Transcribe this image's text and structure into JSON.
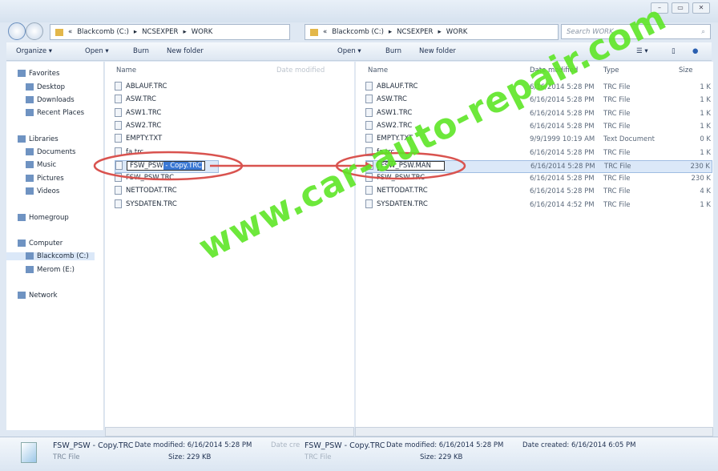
{
  "window": {
    "buttons": [
      "minimize",
      "maximize",
      "close"
    ]
  },
  "address": {
    "left": [
      "«",
      "Blackcomb (C:)",
      "▸",
      "NCSEXPER",
      "▸",
      "WORK"
    ],
    "right": [
      "«",
      "Blackcomb (C:)",
      "▸",
      "NCSEXPER",
      "▸",
      "WORK"
    ]
  },
  "search": {
    "placeholder": "Search WORK"
  },
  "toolbar": {
    "organize": "Organize ▾",
    "open": "Open ▾",
    "burn": "Burn",
    "new_folder": "New folder"
  },
  "nav": {
    "items": [
      {
        "label": "Favorites",
        "icon": "star-icon"
      },
      {
        "label": "Desktop",
        "icon": "desktop-icon"
      },
      {
        "label": "Downloads",
        "icon": "downloads-icon"
      },
      {
        "label": "Recent Places",
        "icon": "recent-icon"
      },
      {
        "label": "Libraries",
        "icon": "libraries-icon"
      },
      {
        "label": "Documents",
        "icon": "documents-icon"
      },
      {
        "label": "Music",
        "icon": "music-icon"
      },
      {
        "label": "Pictures",
        "icon": "pictures-icon"
      },
      {
        "label": "Videos",
        "icon": "videos-icon"
      },
      {
        "label": "Homegroup",
        "icon": "homegroup-icon"
      },
      {
        "label": "Computer",
        "icon": "computer-icon"
      },
      {
        "label": "Blackcomb (C:)",
        "icon": "drive-icon"
      },
      {
        "label": "Merom (E:)",
        "icon": "drive-icon"
      },
      {
        "label": "Network",
        "icon": "network-icon"
      }
    ]
  },
  "columns": {
    "name": "Name",
    "date": "Date modified",
    "type": "Type",
    "size": "Size"
  },
  "left_files": [
    "ABLAUF.TRC",
    "ASW.TRC",
    "ASW1.TRC",
    "ASW2.TRC",
    "EMPTY.TXT",
    "fa.trc",
    "FSW_PSW",
    "FSW_PSW.TRC",
    "NETTODAT.TRC",
    "SYSDATEN.TRC"
  ],
  "left_edit": {
    "base": "FSW_PSW",
    "selected": " - Copy.TRC"
  },
  "right_files": [
    {
      "name": "ABLAUF.TRC",
      "date": "6/16/2014 5:28 PM",
      "type": "TRC File",
      "size": "1 K"
    },
    {
      "name": "ASW.TRC",
      "date": "6/16/2014 5:28 PM",
      "type": "TRC File",
      "size": "1 K"
    },
    {
      "name": "ASW1.TRC",
      "date": "6/16/2014 5:28 PM",
      "type": "TRC File",
      "size": "1 K"
    },
    {
      "name": "ASW2.TRC",
      "date": "6/16/2014 5:28 PM",
      "type": "TRC File",
      "size": "1 K"
    },
    {
      "name": "EMPTY.TXT",
      "date": "9/9/1999 10:19 AM",
      "type": "Text Document",
      "size": "0 K"
    },
    {
      "name": "fa.trc",
      "date": "6/16/2014 5:28 PM",
      "type": "TRC File",
      "size": "1 K"
    },
    {
      "name": "FSW_PSW.MAN",
      "date": "6/16/2014 5:28 PM",
      "type": "TRC File",
      "size": "230 K"
    },
    {
      "name": "FSW_PSW.TRC",
      "date": "6/16/2014 5:28 PM",
      "type": "TRC File",
      "size": "230 K"
    },
    {
      "name": "NETTODAT.TRC",
      "date": "6/16/2014 5:28 PM",
      "type": "TRC File",
      "size": "4 K"
    },
    {
      "name": "SYSDATEN.TRC",
      "date": "6/16/2014 4:52 PM",
      "type": "TRC File",
      "size": "1 K"
    }
  ],
  "details": {
    "name": "FSW_PSW - Copy.TRC",
    "type": "TRC File",
    "modified": "Date modified: 6/16/2014 5:28 PM",
    "size": "Size: 229 KB",
    "created_partial": "Date cre",
    "name2": "FSW_PSW - Copy.TRC",
    "type2": "TRC File",
    "modified2": "Date modified: 6/16/2014 5:28 PM",
    "size2": "Size: 229 KB",
    "created": "Date created: 6/16/2014 6:05 PM"
  },
  "watermark": "www.car-auto-repair.com",
  "colors": {
    "annotation": "#d9534f",
    "watermark": "#5ee626",
    "selection": "#3a78d4"
  }
}
